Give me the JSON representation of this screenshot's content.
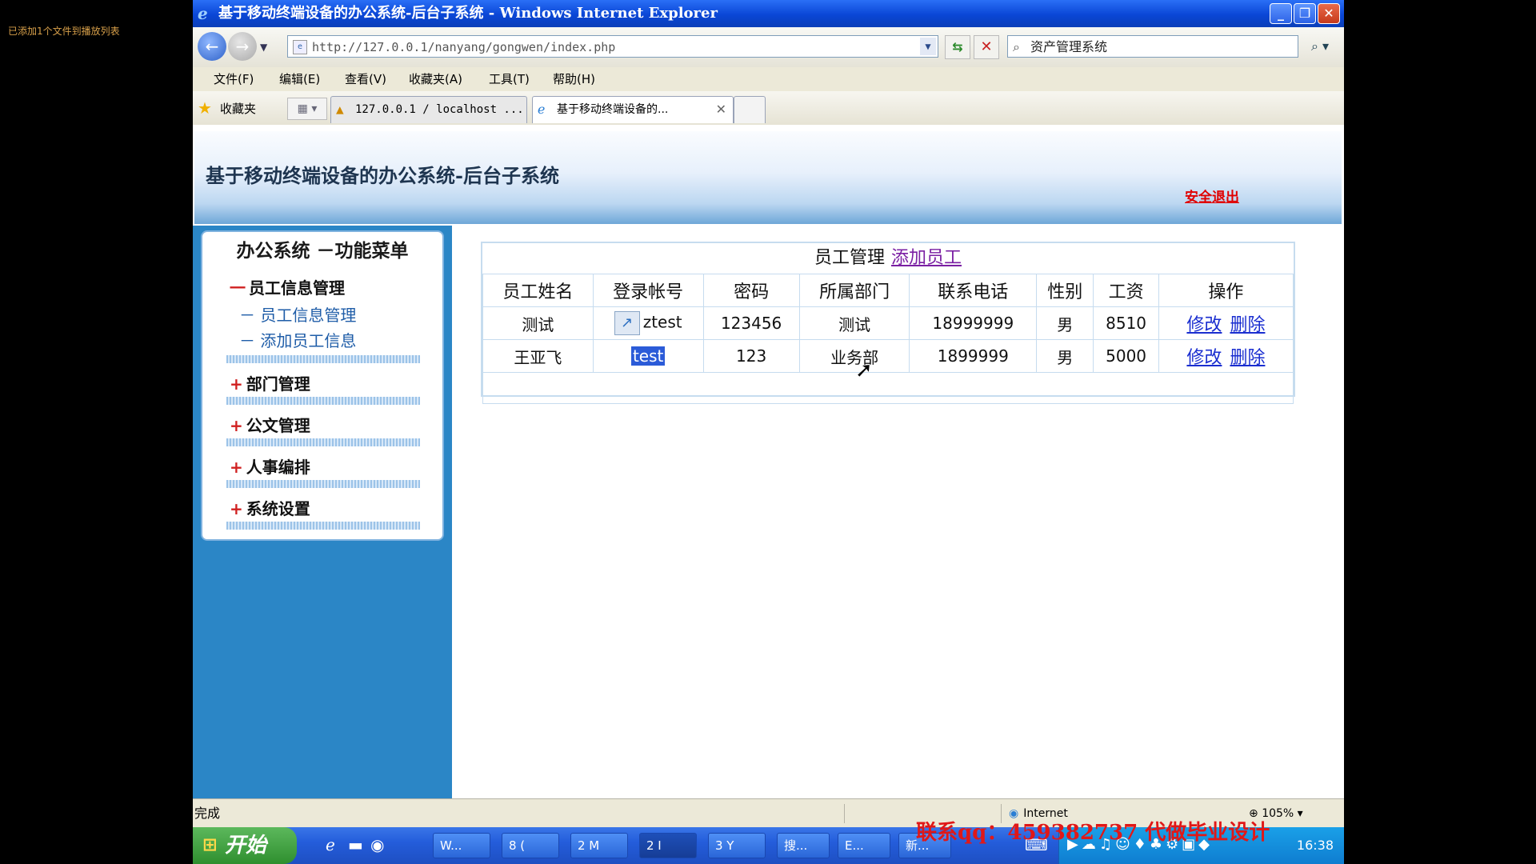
{
  "overlay_text": "已添加1个文件到播放列表",
  "window": {
    "title": "基于移动终端设备的办公系统-后台子系统 - Windows Internet Explorer",
    "min": "_",
    "restore": "❐",
    "close": "✕"
  },
  "address": {
    "url": "http://127.0.0.1/nanyang/gongwen/index.php",
    "search_value": "资产管理系统"
  },
  "menu": [
    "文件(F)",
    "编辑(E)",
    "查看(V)",
    "收藏夹(A)",
    "工具(T)",
    "帮助(H)"
  ],
  "favorites": {
    "label": "收藏夹",
    "tabs": [
      "127.0.0.1 / localhost ...",
      "基于移动终端设备的..."
    ]
  },
  "page": {
    "header_title": "基于移动终端设备的办公系统-后台子系统",
    "logout": "安全退出",
    "sidebar": {
      "title": "办公系统 －功能菜单",
      "groups": [
        {
          "sign": "一",
          "label": "员工信息管理"
        },
        {
          "sign": "+",
          "label": "部门管理"
        },
        {
          "sign": "+",
          "label": "公文管理"
        },
        {
          "sign": "+",
          "label": "人事编排"
        },
        {
          "sign": "+",
          "label": "系统设置"
        }
      ],
      "subitems": [
        "－ 员工信息管理",
        "－ 添加员工信息"
      ]
    },
    "table": {
      "title": "员工管理",
      "add_link": "添加员工",
      "headers": [
        "员工姓名",
        "登录帐号",
        "密码",
        "所属部门",
        "联系电话",
        "性别",
        "工资",
        "操作"
      ],
      "rows": [
        {
          "name": "测试",
          "account": "ztest",
          "password": "123456",
          "dept": "测试",
          "phone": "18999999",
          "gender": "男",
          "salary": "8510",
          "edit": "修改",
          "delete": "删除"
        },
        {
          "name": "王亚飞",
          "account": "test",
          "password": "123",
          "dept": "业务部",
          "phone": "1899999",
          "gender": "男",
          "salary": "5000",
          "edit": "修改",
          "delete": "删除"
        }
      ]
    }
  },
  "status": {
    "text": "完成",
    "zone": "Internet",
    "zoom": "105%"
  },
  "taskbar": {
    "start": "开始",
    "buttons": [
      "W...",
      "8 (",
      "2 M",
      "2 I",
      "3 Y",
      "搜...",
      "E...",
      "新..."
    ],
    "clock": "16:38"
  },
  "watermark": "联系qq：459382737 代做毕业设计",
  "colors": {
    "accent": "#2b86c6",
    "logout": "#e00000",
    "link": "#1a2ed0"
  }
}
